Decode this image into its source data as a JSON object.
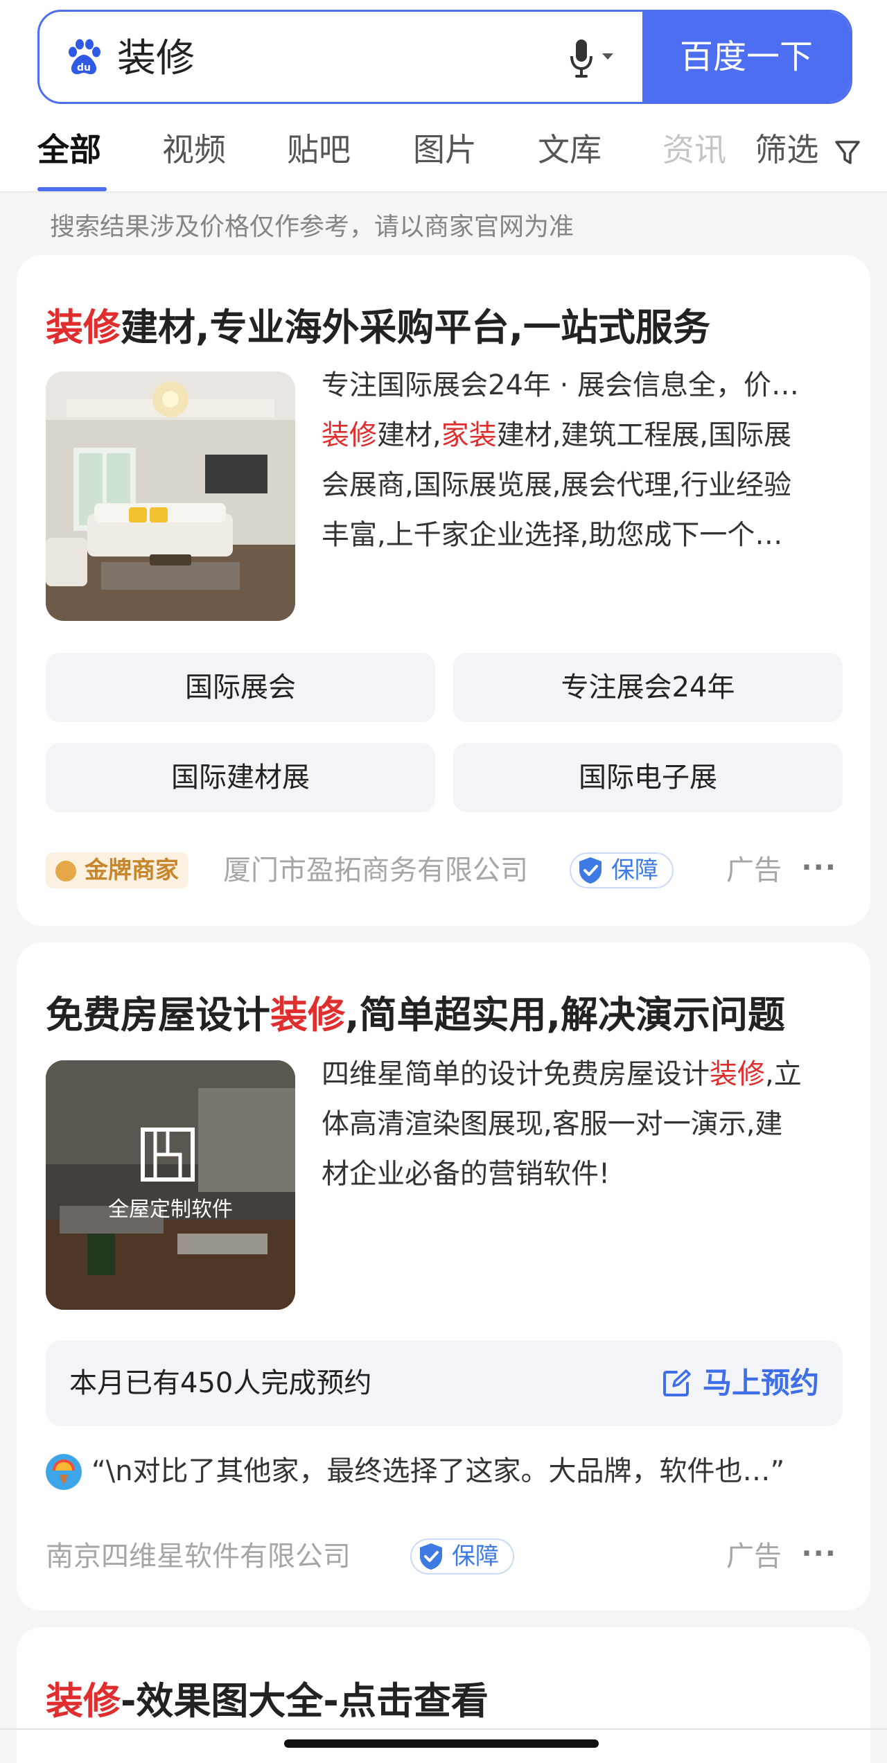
{
  "search": {
    "query": "装修",
    "button_label": "百度一下"
  },
  "tabs": [
    {
      "label": "全部"
    },
    {
      "label": "视频"
    },
    {
      "label": "贴吧"
    },
    {
      "label": "图片"
    },
    {
      "label": "文库"
    },
    {
      "label": "资讯"
    }
  ],
  "filter_label": "筛选",
  "notice": "搜索结果涉及价格仅作参考，请以商家官网为准",
  "card1": {
    "title_highlight": "装修",
    "title_rest": "建材,专业海外采购平台,一站式服务",
    "desc_line1": "专注国际展会24年 · 展会信息全，价…",
    "desc_line2_hl1": "装修",
    "desc_line2_t1": "建材,",
    "desc_line2_hl2": "家装",
    "desc_line2_t2": "建材,建筑工程展,国际展",
    "desc_line3": "会展商,国际展览展,展会代理,行业经验",
    "desc_line4": "丰富,上千家企业选择,助您成下一个…",
    "chips": [
      "国际展会",
      "专注展会24年",
      "国际建材展",
      "国际电子展"
    ],
    "badge": "金牌商家",
    "company": "厦门市盈拓商务有限公司",
    "guarantee": "保障",
    "ad": "广告",
    "more": "···"
  },
  "card2": {
    "title_pre": "免费房屋设计",
    "title_highlight": "装修",
    "title_post": ",简单超实用,解决演示问题",
    "desc_line1_pre": "四维星简单的设计免费房屋设计",
    "desc_line1_hl": "装修",
    "desc_line1_post": ",立",
    "desc_line2": "体高清渲染图展现,客服一对一演示,建",
    "desc_line3": "材企业必备的营销软件!",
    "thumb_caption": "全屋定制软件",
    "booking_text": "本月已有450人完成预约",
    "booking_cta": "马上预约",
    "review": "“\\n对比了其他家，最终选择了这家。大品牌，软件也…”",
    "company": "南京四维星软件有限公司",
    "guarantee": "保障",
    "ad": "广告",
    "more": "···"
  },
  "card3": {
    "title_highlight": "装修",
    "title_rest": "-效果图大全-点击查看"
  },
  "colors": {
    "accent": "#4e6ef2",
    "highlight": "#e02d2d",
    "gold": "#c8862c",
    "guarantee": "#3e7ae3"
  }
}
